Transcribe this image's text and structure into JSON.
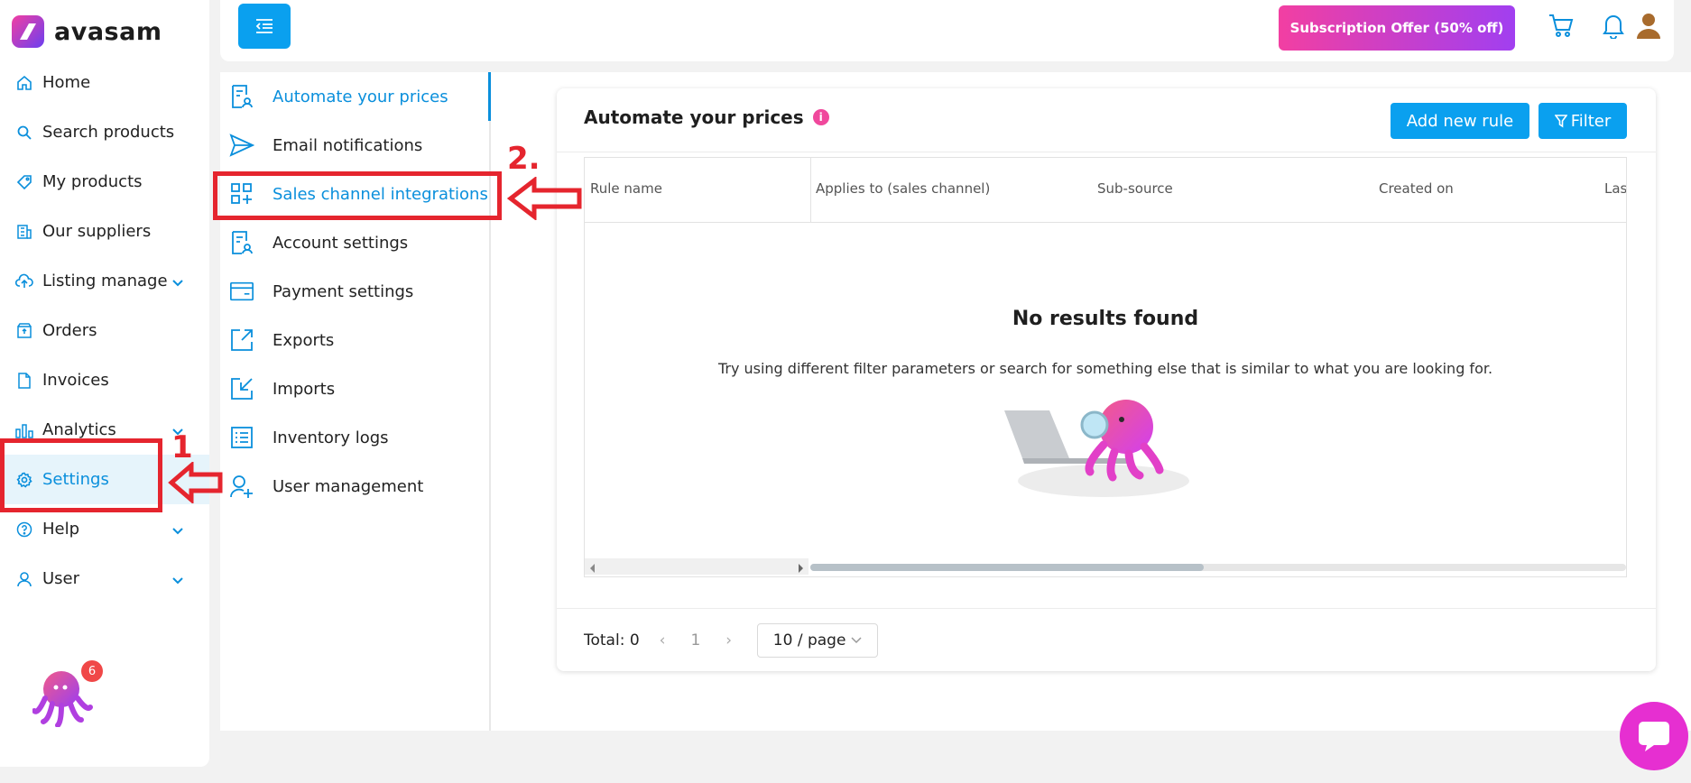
{
  "app": {
    "name": "avasam"
  },
  "sidebar": {
    "items": [
      {
        "label": "Home",
        "icon": "home-icon"
      },
      {
        "label": "Search products",
        "icon": "search-icon"
      },
      {
        "label": "My products",
        "icon": "tag-icon"
      },
      {
        "label": "Our suppliers",
        "icon": "building-icon"
      },
      {
        "label": "Listing manage",
        "icon": "cloud-upload-icon"
      },
      {
        "label": "Orders",
        "icon": "box-icon"
      },
      {
        "label": "Invoices",
        "icon": "document-icon"
      },
      {
        "label": "Analytics",
        "icon": "bar-chart-icon"
      },
      {
        "label": "Settings",
        "icon": "gear-icon"
      },
      {
        "label": "Help",
        "icon": "help-icon"
      },
      {
        "label": "User",
        "icon": "user-icon"
      }
    ],
    "active": "Settings",
    "bot_badge": "6"
  },
  "topbar": {
    "offer_label": "Subscription Offer (50% off)"
  },
  "settings_menu": {
    "items": [
      {
        "label": "Automate your prices",
        "icon": "price-rule-icon"
      },
      {
        "label": "Email notifications",
        "icon": "send-icon"
      },
      {
        "label": "Sales channel integrations",
        "icon": "apps-add-icon"
      },
      {
        "label": "Account settings",
        "icon": "account-doc-icon"
      },
      {
        "label": "Payment settings",
        "icon": "card-icon"
      },
      {
        "label": "Exports",
        "icon": "export-icon"
      },
      {
        "label": "Imports",
        "icon": "import-icon"
      },
      {
        "label": "Inventory logs",
        "icon": "list-icon"
      },
      {
        "label": "User management",
        "icon": "user-add-icon"
      }
    ],
    "active": "Automate your prices"
  },
  "main": {
    "title": "Automate your prices",
    "info_icon": "i",
    "add_rule_label": "Add new rule",
    "filter_label": "Filter",
    "columns": [
      "Rule name",
      "Applies to (sales channel)",
      "Sub-source",
      "Created on",
      "Las"
    ],
    "empty_title": "No results found",
    "empty_sub": "Try using different filter parameters or search for something else that is similar to what you are looking for.",
    "pager": {
      "total": "Total: 0",
      "page": "1",
      "page_size": "10 / page"
    }
  },
  "annotations": {
    "step1": "1",
    "step2": "2."
  },
  "colors": {
    "accent": "#0aa0ef",
    "annotation": "#e5252e",
    "offer_start": "#f23fa2",
    "offer_end": "#a13ff0"
  }
}
